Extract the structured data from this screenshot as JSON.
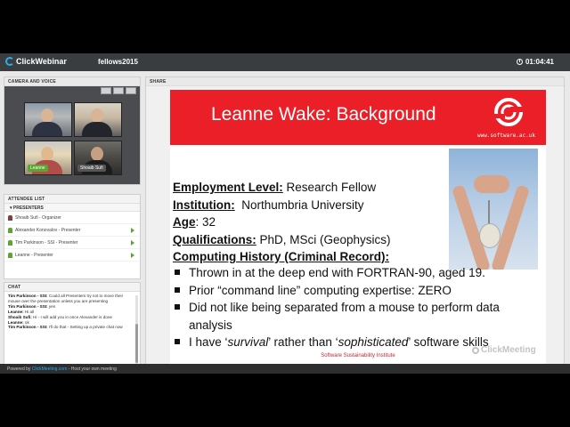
{
  "topbar": {
    "brand": "ClickWebinar",
    "webinar_name": "fellows2015",
    "timer": "01:04:41"
  },
  "camera_panel": {
    "title": "CAMERA AND VOICE",
    "videos": [
      {
        "label": ""
      },
      {
        "label": ""
      },
      {
        "label": "Leanne"
      },
      {
        "label": "Shoaib Sufi"
      }
    ]
  },
  "attendee_panel": {
    "title": "ATTENDEE LIST",
    "group_label": "PRESENTERS",
    "attendees": [
      {
        "name": "Shoaib Sufi - Organizer"
      },
      {
        "name": "Alexander Konovalov - Presenter"
      },
      {
        "name": "Tim Parkinson - SSI - Presenter"
      },
      {
        "name": "Leanne - Presenter"
      }
    ]
  },
  "chat_panel": {
    "title": "CHAT",
    "messages": [
      {
        "author": "Tim Parkinson - SSI:",
        "text": " Could all Presenters try not to move their mouse over the presentation unless you are presenting"
      },
      {
        "author": "Tim Parkinson - SSI:",
        "text": " yes"
      },
      {
        "author": "Leanne:",
        "text": " Hi all"
      },
      {
        "author": "Shoaib Sufi:",
        "text": " Hi - I will add you in once Alexander is done"
      },
      {
        "author": "Leanne:",
        "text": " ok"
      },
      {
        "author": "Tim Parkinson - SSI:",
        "text": " I'll do that - Setting up a private chat now"
      }
    ]
  },
  "share_panel": {
    "title": "SHARE"
  },
  "slide": {
    "title": "Leanne Wake: Background",
    "url": "www.software.ac.uk",
    "info": [
      {
        "label": "Employment Level:",
        "value": " Research Fellow"
      },
      {
        "label": "Institution:",
        "value": "  Northumbria University"
      },
      {
        "label": "Age",
        "value": ": 32"
      },
      {
        "label": "Qualifications:",
        "value": " PhD, MSci (Geophysics)"
      },
      {
        "label": "Computing History (Criminal Record):",
        "value": ""
      }
    ],
    "bullets": [
      {
        "text": "Thrown in at the deep end with FORTRAN-90, aged 19."
      },
      {
        "text": "Prior “command line” computing expertise: ZERO"
      },
      {
        "text": "Did not like being separated from a mouse to perform data analysis"
      },
      {
        "pre": "I have ‘",
        "em1": "survival",
        "mid": "’ rather than ‘",
        "em2": "sophisticated",
        "post": "’ software skills"
      }
    ],
    "footer": "Software Sustainability Institute"
  },
  "watermark": "ClickMeeting",
  "bottom_bar": {
    "prefix": "Powered by ",
    "link": "ClickMeeting.com",
    "suffix": " - Host your own meeting"
  },
  "colors": {
    "brand_red": "#ea1f27",
    "accent_green": "#5aa630",
    "brand_blue": "#36a9e1"
  }
}
